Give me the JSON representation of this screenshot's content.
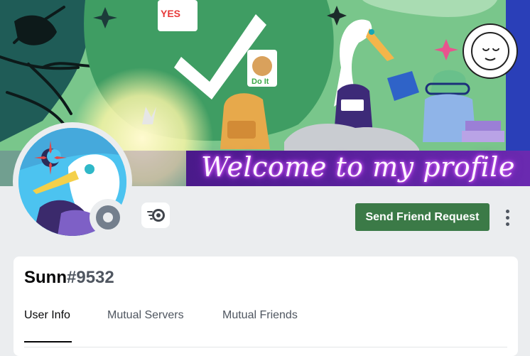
{
  "banner": {
    "text": "Welcome to my profile",
    "stickers": {
      "yes": "YES",
      "do_it": "Do It"
    }
  },
  "profile": {
    "username": "Sunn",
    "discriminator": "#9532",
    "status": "offline",
    "badge_icon": "nitro-badge-icon"
  },
  "actions": {
    "send_friend_request": "Send Friend Request",
    "more_icon": "more-vertical-icon"
  },
  "tabs": [
    {
      "label": "User Info",
      "active": true
    },
    {
      "label": "Mutual Servers",
      "active": false
    },
    {
      "label": "Mutual Friends",
      "active": false
    }
  ],
  "colors": {
    "button_green": "#3b7a47",
    "banner_green": "#79c68b",
    "status_gray": "#747f8d",
    "background": "#ebedef"
  }
}
